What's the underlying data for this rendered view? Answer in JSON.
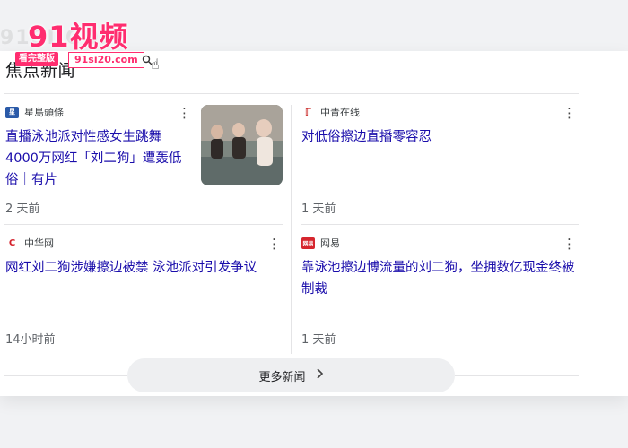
{
  "section": {
    "title": "焦点新闻"
  },
  "articles": [
    {
      "source": "星島頭條",
      "source_color": "#2a5aa8",
      "headline": "直播泳池派对性感女生跳舞4000万网红「刘二狗」遭轰低俗｜有片",
      "time": "2 天前",
      "has_thumb": true
    },
    {
      "source": "中青在线",
      "source_color": "#c8201e",
      "headline": "对低俗擦边直播零容忍",
      "time": "1 天前",
      "has_thumb": false
    },
    {
      "source": "中华网",
      "source_color": "#d4202a",
      "headline": "网红刘二狗涉嫌擦边被禁 泳池派对引发争议",
      "time": "14小时前",
      "has_thumb": false
    },
    {
      "source": "网易",
      "source_color": "#d6262e",
      "headline": "靠泳池擦边博流量的刘二狗，坐拥数亿现金终被制裁",
      "time": "1 天前",
      "has_thumb": false
    }
  ],
  "more_button": {
    "label": "更多新闻"
  },
  "watermark": {
    "brand": "91视频",
    "tag": "看完整版",
    "url": "91si20.com"
  }
}
